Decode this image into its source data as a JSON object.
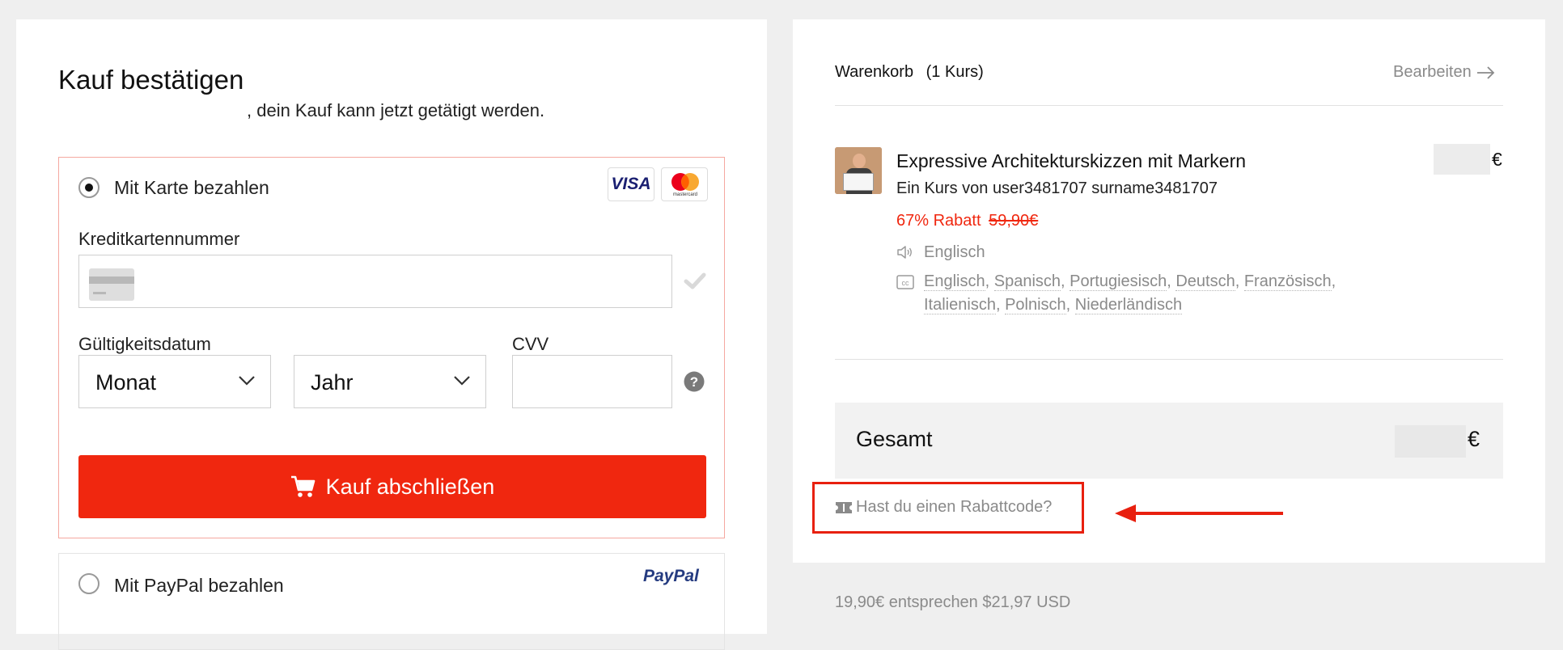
{
  "checkout": {
    "title": "Kauf bestätigen",
    "subtitle": ", dein Kauf kann jetzt getätigt werden.",
    "card_option_label": "Mit Karte bezahlen",
    "card_number_label": "Kreditkartennummer",
    "card_number_value": "",
    "expiry_label": "Gültigkeitsdatum",
    "month_select": "Monat",
    "year_select": "Jahr",
    "cvv_label": "CVV",
    "cvv_value": "",
    "submit_label": "Kauf abschließen",
    "paypal_option_label": "Mit PayPal bezahlen",
    "paypal_logo": "PayPal",
    "visa_logo": "VISA",
    "mastercard_logo": "mastercard"
  },
  "cart": {
    "title": "Warenkorb",
    "count": "(1 Kurs)",
    "edit_label": "Bearbeiten",
    "item": {
      "name": "Expressive Architekturskizzen mit Markern",
      "author": "Ein Kurs von user3481707 surname3481707",
      "discount": "67% Rabatt",
      "old_price": "59,90€",
      "price_currency": "€",
      "audio_language": "Englisch",
      "subtitle_languages": [
        "Englisch",
        "Spanisch",
        "Portugiesisch",
        "Deutsch",
        "Französisch",
        "Italienisch",
        "Polnisch",
        "Niederländisch"
      ]
    },
    "total_label": "Gesamt",
    "total_currency": "€",
    "coupon_label": "Hast du einen Rabattcode?",
    "footer_note": "19,90€ entsprechen $21,97 USD"
  },
  "colors": {
    "accent_red": "#f0270f",
    "annotation_red": "#e8200f",
    "background": "#efefef"
  },
  "icons": [
    "cart-icon",
    "check-icon",
    "chevron-down-icon",
    "help-icon",
    "arrow-right-icon",
    "speaker-icon",
    "cc-icon",
    "ticket-icon"
  ]
}
